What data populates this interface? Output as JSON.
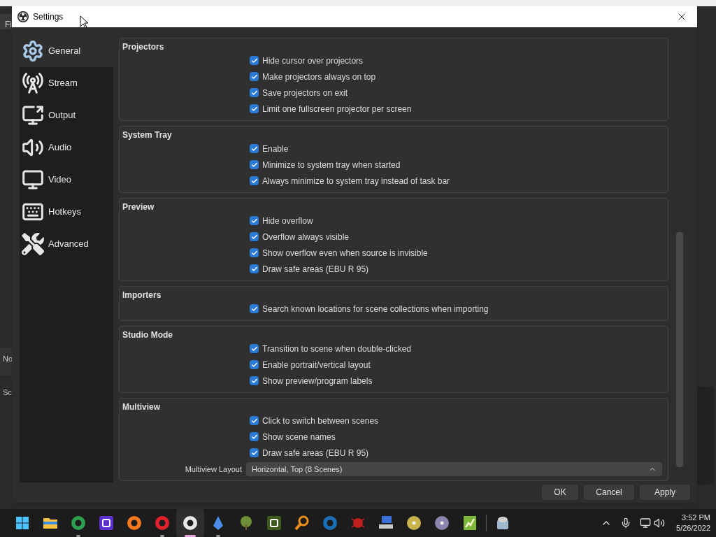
{
  "background_window": {
    "fragments": [
      "Fi",
      "No",
      "Sc"
    ]
  },
  "dialog": {
    "title": "Settings"
  },
  "sidebar": {
    "items": [
      {
        "kind": "gear",
        "label": "General",
        "selected": true
      },
      {
        "kind": "tower",
        "label": "Stream",
        "selected": false
      },
      {
        "kind": "output",
        "label": "Output",
        "selected": false
      },
      {
        "kind": "speaker",
        "label": "Audio",
        "selected": false
      },
      {
        "kind": "monitor",
        "label": "Video",
        "selected": false
      },
      {
        "kind": "keyboard",
        "label": "Hotkeys",
        "selected": false
      },
      {
        "kind": "tools",
        "label": "Advanced",
        "selected": false
      }
    ]
  },
  "sections": [
    {
      "title": "Projectors",
      "items": [
        {
          "kind": "checkbox",
          "label": "Hide cursor over projectors",
          "checked": true
        },
        {
          "kind": "checkbox",
          "label": "Make projectors always on top",
          "checked": true
        },
        {
          "kind": "checkbox",
          "label": "Save projectors on exit",
          "checked": true
        },
        {
          "kind": "checkbox",
          "label": "Limit one fullscreen projector per screen",
          "checked": true
        }
      ]
    },
    {
      "title": "System Tray",
      "items": [
        {
          "kind": "checkbox",
          "label": "Enable",
          "checked": true
        },
        {
          "kind": "checkbox",
          "label": "Minimize to system tray when started",
          "checked": true
        },
        {
          "kind": "checkbox",
          "label": "Always minimize to system tray instead of task bar",
          "checked": true
        }
      ]
    },
    {
      "title": "Preview",
      "items": [
        {
          "kind": "checkbox",
          "label": "Hide overflow",
          "checked": true
        },
        {
          "kind": "checkbox",
          "label": "Overflow always visible",
          "checked": true
        },
        {
          "kind": "checkbox",
          "label": "Show overflow even when source is invisible",
          "checked": true
        },
        {
          "kind": "checkbox",
          "label": "Draw safe areas (EBU R 95)",
          "checked": true
        }
      ]
    },
    {
      "title": "Importers",
      "items": [
        {
          "kind": "checkbox",
          "label": "Search known locations for scene collections when importing",
          "checked": true
        }
      ]
    },
    {
      "title": "Studio Mode",
      "items": [
        {
          "kind": "checkbox",
          "label": "Transition to scene when double-clicked",
          "checked": true
        },
        {
          "kind": "checkbox",
          "label": "Enable portrait/vertical layout",
          "checked": true
        },
        {
          "kind": "checkbox",
          "label": "Show preview/program labels",
          "checked": true
        }
      ]
    },
    {
      "title": "Multiview",
      "items": [
        {
          "kind": "checkbox",
          "label": "Click to switch between scenes",
          "checked": true
        },
        {
          "kind": "checkbox",
          "label": "Show scene names",
          "checked": true
        },
        {
          "kind": "checkbox",
          "label": "Draw safe areas (EBU R 95)",
          "checked": true
        },
        {
          "kind": "dropdown",
          "label": "Multiview Layout",
          "value": "Horizontal, Top (8 Scenes)"
        }
      ]
    }
  ],
  "buttons": [
    "OK",
    "Cancel",
    "Apply"
  ],
  "taskbar": {
    "apps": [
      {
        "kind": "start",
        "running": false,
        "selected": false,
        "color": "#4cc2ff"
      },
      {
        "kind": "folder",
        "running": false,
        "selected": false,
        "color": "#f5c242"
      },
      {
        "kind": "ring",
        "running": true,
        "selected": false,
        "color": "#2e9e4f"
      },
      {
        "kind": "tile",
        "running": false,
        "selected": false,
        "color": "#5b2fc9"
      },
      {
        "kind": "ring",
        "running": false,
        "selected": false,
        "color": "#f47a20"
      },
      {
        "kind": "ring",
        "running": true,
        "selected": false,
        "color": "#e0202c"
      },
      {
        "kind": "ring",
        "running": true,
        "selected": true,
        "color": "#e8e8e8"
      },
      {
        "kind": "crystal",
        "running": true,
        "selected": false,
        "color": "#4d8fe8"
      },
      {
        "kind": "tree",
        "running": false,
        "selected": false,
        "color": "#6f8f3a"
      },
      {
        "kind": "tile",
        "running": false,
        "selected": false,
        "color": "#3c5a1e"
      },
      {
        "kind": "magnifier",
        "running": false,
        "selected": false,
        "color": "#f0901e"
      },
      {
        "kind": "ring",
        "running": false,
        "selected": false,
        "color": "#1b6fb5"
      },
      {
        "kind": "bug",
        "running": false,
        "selected": false,
        "color": "#c02020"
      },
      {
        "kind": "computer",
        "running": false,
        "selected": false,
        "color": "#3a6ed8"
      },
      {
        "kind": "disc",
        "running": false,
        "selected": false,
        "color": "#c9b34a"
      },
      {
        "kind": "disc",
        "running": false,
        "selected": false,
        "color": "#8a86b0"
      },
      {
        "kind": "chart",
        "running": false,
        "selected": false,
        "color": "#7db83a"
      },
      {
        "kind": "disk",
        "running": false,
        "selected": false,
        "color": "#9fb8d0"
      }
    ],
    "time": "3:52 PM",
    "date": "5/26/2022"
  }
}
